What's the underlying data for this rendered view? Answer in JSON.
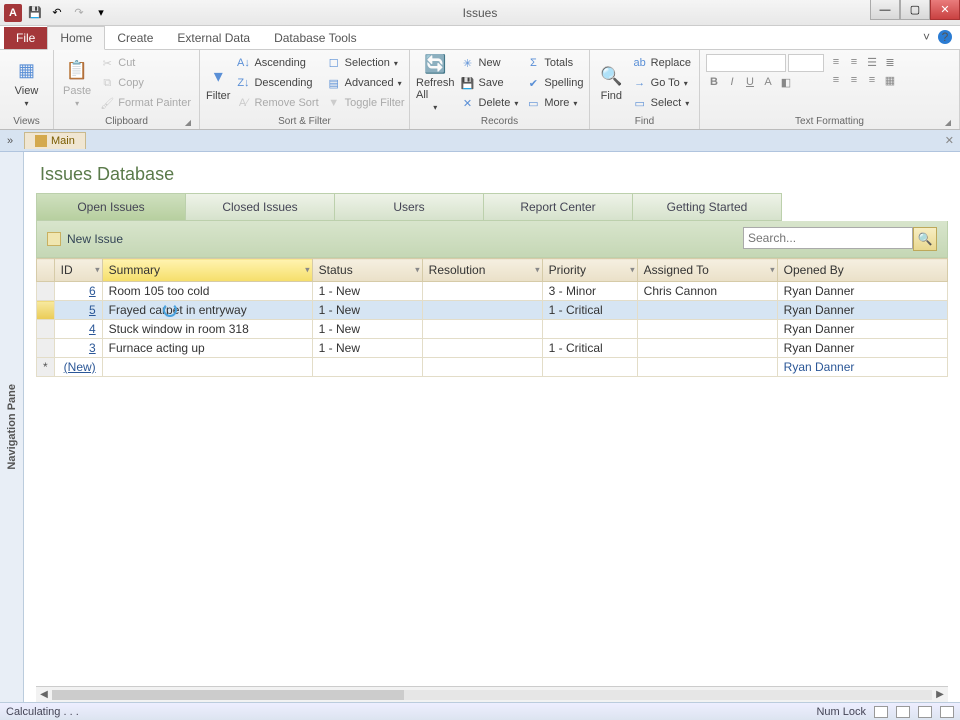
{
  "window": {
    "title": "Issues"
  },
  "qat": {
    "save": "💾",
    "undo": "↶",
    "redo": "↷",
    "custom": "▾"
  },
  "tabs": {
    "file": "File",
    "home": "Home",
    "create": "Create",
    "external": "External Data",
    "dbtools": "Database Tools"
  },
  "ribbon": {
    "views": {
      "view": "View",
      "group": "Views"
    },
    "clipboard": {
      "paste": "Paste",
      "cut": "Cut",
      "copy": "Copy",
      "fmt": "Format Painter",
      "group": "Clipboard"
    },
    "sortfilter": {
      "filter": "Filter",
      "asc": "Ascending",
      "desc": "Descending",
      "remove": "Remove Sort",
      "selection": "Selection",
      "advanced": "Advanced",
      "toggle": "Toggle Filter",
      "group": "Sort & Filter"
    },
    "records": {
      "refresh": "Refresh All",
      "new": "New",
      "save": "Save",
      "delete": "Delete",
      "totals": "Totals",
      "spelling": "Spelling",
      "more": "More",
      "group": "Records"
    },
    "find": {
      "find": "Find",
      "replace": "Replace",
      "goto": "Go To",
      "select": "Select",
      "group": "Find"
    },
    "textfmt": {
      "group": "Text Formatting"
    }
  },
  "doctab": {
    "main": "Main"
  },
  "navpane": {
    "label": "Navigation Pane"
  },
  "db": {
    "heading": "Issues Database",
    "tabs": {
      "open": "Open Issues",
      "closed": "Closed Issues",
      "users": "Users",
      "report": "Report Center",
      "started": "Getting Started"
    },
    "newissue": "New Issue",
    "search_placeholder": "Search..."
  },
  "grid": {
    "cols": {
      "id": "ID",
      "summary": "Summary",
      "status": "Status",
      "resolution": "Resolution",
      "priority": "Priority",
      "assigned": "Assigned To",
      "opened": "Opened By"
    },
    "rows": [
      {
        "id": "6",
        "summary": "Room 105 too cold",
        "status": "1 - New",
        "resolution": "",
        "priority": "3 - Minor",
        "assigned": "Chris Cannon",
        "opened": "Ryan Danner"
      },
      {
        "id": "5",
        "summary": "Frayed carpet in entryway",
        "status": "1 - New",
        "resolution": "",
        "priority": "1 - Critical",
        "assigned": "",
        "opened": "Ryan Danner"
      },
      {
        "id": "4",
        "summary": "Stuck window in room 318",
        "status": "1 - New",
        "resolution": "",
        "priority": "",
        "assigned": "",
        "opened": "Ryan Danner"
      },
      {
        "id": "3",
        "summary": "Furnace acting up",
        "status": "1 - New",
        "resolution": "",
        "priority": "1 - Critical",
        "assigned": "",
        "opened": "Ryan Danner"
      }
    ],
    "newrow": {
      "label": "(New)",
      "opened": "Ryan Danner"
    }
  },
  "status": {
    "left": "Calculating . . .",
    "numlock": "Num Lock"
  }
}
